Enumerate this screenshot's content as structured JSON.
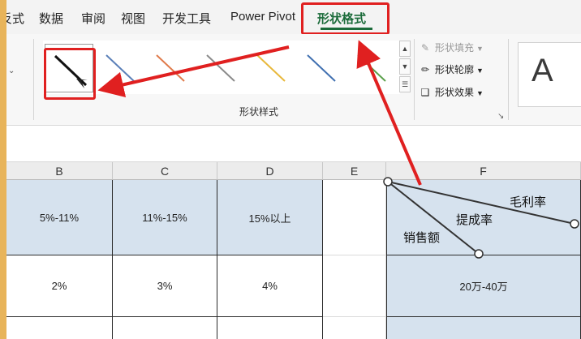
{
  "ribbon": {
    "tabs": [
      "反式",
      "数据",
      "审阅",
      "视图",
      "开发工具",
      "Power Pivot",
      "形状格式"
    ],
    "active_tab": "形状格式",
    "group_label": "形状样式",
    "fill_label": "形状填充",
    "outline_label": "形状轮廓",
    "effects_label": "形状效果",
    "wordart_letter": "A",
    "gallery_colors": [
      "#111111",
      "#5a7fb8",
      "#e07a4a",
      "#8a8a8a",
      "#e8b83a",
      "#3f6fb0",
      "#5aa04a"
    ]
  },
  "sheet": {
    "columns": [
      "B",
      "C",
      "D",
      "E",
      "F"
    ],
    "row1": [
      "5%-11%",
      "11%-15%",
      "15%以上"
    ],
    "row2": [
      "2%",
      "3%",
      "4%"
    ],
    "f2": "20万-40万",
    "diag_labels": {
      "top": "毛利率",
      "middle": "提成率",
      "bottom": "销售额"
    }
  },
  "colors": {
    "accent_green": "#1b6b3a",
    "annotation_red": "#e02020",
    "header_blue": "#d6e2ee",
    "window_frame": "#e8b45a"
  }
}
